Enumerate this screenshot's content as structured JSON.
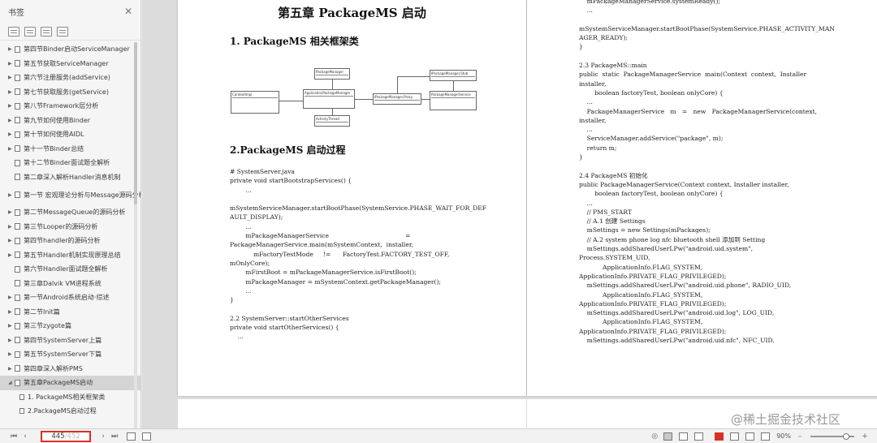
{
  "sidebar": {
    "title": "书签",
    "items": [
      {
        "label": "第四节Binder启动ServiceManager",
        "type": "collapsed"
      },
      {
        "label": "第五节获取ServiceManager",
        "type": "collapsed"
      },
      {
        "label": "第六节注册服务(addService)",
        "type": "collapsed"
      },
      {
        "label": "第七节获取服务(getService)",
        "type": "collapsed"
      },
      {
        "label": "第八节Framework层分析",
        "type": "collapsed"
      },
      {
        "label": "第九节如何使用Binder",
        "type": "collapsed"
      },
      {
        "label": "第十节如何使用AIDL",
        "type": "collapsed"
      },
      {
        "label": "第十一节Binder总结",
        "type": "collapsed"
      },
      {
        "label": "第十二节Binder面试题全解析",
        "type": "leaf"
      },
      {
        "label": "第二章深入解析Handler消息机制",
        "type": "leaf"
      },
      {
        "label": "第一节 宏观理论分析与Message源码分析",
        "type": "collapsed-tall"
      },
      {
        "label": "第二节MessageQueue的源码分析",
        "type": "collapsed"
      },
      {
        "label": "第三节Looper的源码分析",
        "type": "collapsed"
      },
      {
        "label": "第四节handler的源码分析",
        "type": "collapsed"
      },
      {
        "label": "第五节Handler机制实现原理总结",
        "type": "collapsed"
      },
      {
        "label": "第六节Handler面试题全解析",
        "type": "leaf"
      },
      {
        "label": "第三章Dalvik VM进程系统",
        "type": "leaf"
      },
      {
        "label": "第一节Android系统启动·综述",
        "type": "collapsed"
      },
      {
        "label": "第二节Init篇",
        "type": "collapsed"
      },
      {
        "label": "第三节zygote篇",
        "type": "collapsed"
      },
      {
        "label": "第四节SystemServer上篇",
        "type": "collapsed"
      },
      {
        "label": "第五节SystemServer下篇",
        "type": "collapsed"
      },
      {
        "label": "第四章深入解析PMS",
        "type": "collapsed"
      },
      {
        "label": "第五章PackageMS启动",
        "type": "expanded-active"
      },
      {
        "label": "1. PackageMS相关框架类",
        "type": "child"
      },
      {
        "label": "2.PackageMS启动过程",
        "type": "child"
      }
    ]
  },
  "document": {
    "chapter_title": "第五章 PackageMS 启动",
    "section1_title": "1. PackageMS 相关框架类",
    "section2_title": "2.PackageMS 启动过程",
    "uml": {
      "contextimpl": "ContextImpl",
      "packagemanager": "PackageManager",
      "apm": "ApplicationPackageManager",
      "ipm_proxy": "IPackageManager.Proxy",
      "ipm_stub": "IPackageManager.Stub",
      "pms": "PackageManagerService",
      "activitythread": "ActivityThread"
    },
    "left_code": "# SystemServer.java\nprivate void startBootstrapServices() {\n        ...\n\nmSystemServiceManager.startBootPhase(SystemService.PHASE_WAIT_FOR_DEF\nAULT_DISPLAY);\n        ...\n        mPackageManagerService                                       =\nPackageManagerService.main(mSystemContext,  installer,\n            mFactoryTestMode     !=      FactoryTest.FACTORY_TEST_OFF,\nmOnlyCore);\n        mFirstBoot = mPackageManagerService.isFirstBoot();\n        mPackageManager = mSystemContext.getPackageManager();\n        ...\n}\n\n2.2 SystemServer::startOtherServices\nprivate void startOtherServices() {\n    ...",
    "right_code": "    mPackageManagerService.systemReady();\n    ...\n\nmSystemServiceManager.startBootPhase(SystemService.PHASE_ACTIVITY_MAN\nAGER_READY);\n}\n\n2.3 PackageMS::main\npublic  static  PackageManagerService  main(Context  context,  Installer\ninstaller,\n        boolean factoryTest, boolean onlyCore) {\n    ...\n    PackageManagerService   m   =   new   PackageManagerService(context,\ninstaller,\n    ...\n    ServiceManager.addService(\"package\", m);\n    return m;\n}\n\n2.4 PackageMS 初始化\npublic PackageManagerService(Context context, Installer installer,\n        boolean factoryTest, boolean onlyCore) {\n    ...\n    // PMS_START\n    // A.1 创建 Settings\n    mSettings = new Settings(mPackages);\n    // A.2 system phone log nfc bluetooth shell 添加到 Setting\n    mSettings.addSharedUserLPw(\"android.uid.system\",\nProcess.SYSTEM_UID,\n            ApplicationInfo.FLAG_SYSTEM,\nApplicationInfo.PRIVATE_FLAG_PRIVILEGED);\n    mSettings.addSharedUserLPw(\"android.uid.phone\", RADIO_UID,\n            ApplicationInfo.FLAG_SYSTEM,\nApplicationInfo.PRIVATE_FLAG_PRIVILEGED);\n    mSettings.addSharedUserLPw(\"android.uid.log\", LOG_UID,\n            ApplicationInfo.FLAG_SYSTEM,\nApplicationInfo.PRIVATE_FLAG_PRIVILEGED);\n    mSettings.addSharedUserLPw(\"android.uid.nfc\", NFC_UID,"
  },
  "statusbar": {
    "current_page": "445",
    "total_pages": "/452",
    "zoom": "90%"
  },
  "watermark": "@稀土掘金技术社区",
  "colors": {
    "accent": "#d93025",
    "active_item": "#d4d4d4"
  }
}
